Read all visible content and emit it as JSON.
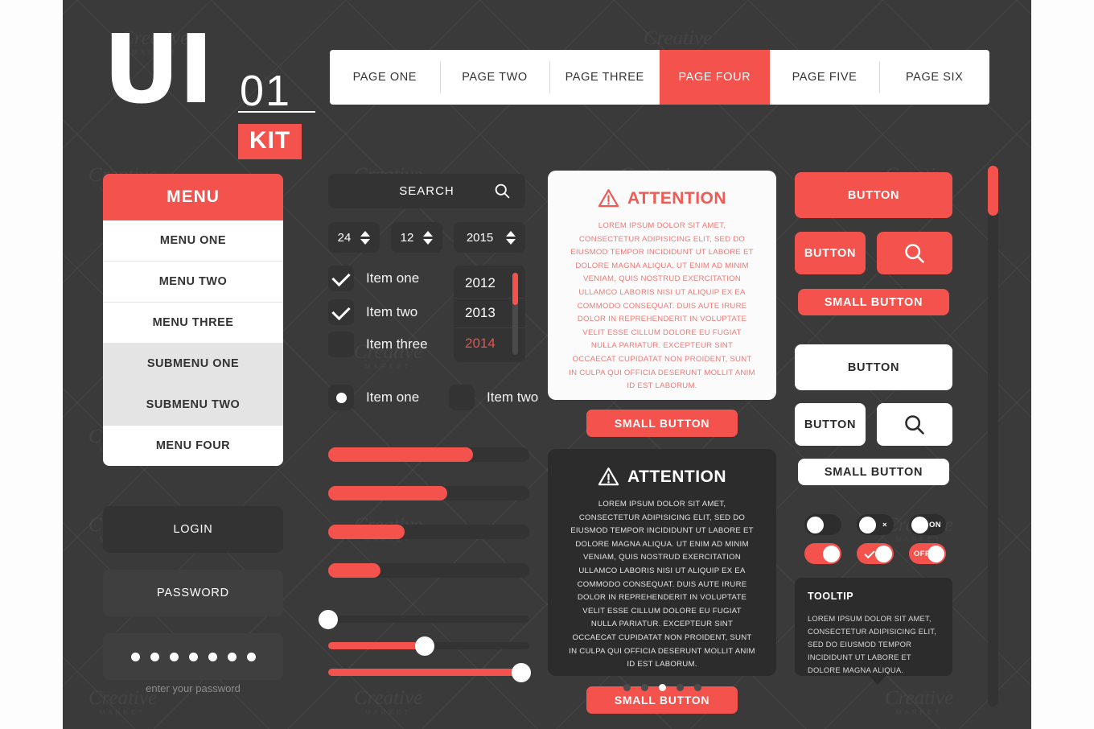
{
  "logo": {
    "ui": "UI",
    "num": "01",
    "kit": "KIT"
  },
  "topnav": {
    "tabs": [
      {
        "label": "PAGE ONE",
        "active": false
      },
      {
        "label": "PAGE TWO",
        "active": false
      },
      {
        "label": "PAGE THREE",
        "active": false
      },
      {
        "label": "PAGE FOUR",
        "active": true
      },
      {
        "label": "PAGE FIVE",
        "active": false
      },
      {
        "label": "PAGE SIX",
        "active": false
      }
    ]
  },
  "menu": {
    "title": "MENU",
    "items": [
      {
        "label": "MENU ONE",
        "sub": false
      },
      {
        "label": "MENU TWO",
        "sub": false
      },
      {
        "label": "MENU THREE",
        "sub": false
      },
      {
        "label": "SUBMENU ONE",
        "sub": true
      },
      {
        "label": "SUBMENU TWO",
        "sub": true
      },
      {
        "label": "MENU FOUR",
        "sub": false
      }
    ]
  },
  "auth": {
    "login_label": "LOGIN",
    "password_label": "PASSWORD",
    "password_dots": 7,
    "hint": "enter your password"
  },
  "search": {
    "label": "SEARCH",
    "icon": "search-icon"
  },
  "steppers": [
    {
      "name": "day",
      "value": "24"
    },
    {
      "name": "month",
      "value": "12"
    },
    {
      "name": "year",
      "value": "2015"
    }
  ],
  "checkboxes": [
    {
      "label": "Item one",
      "checked": true
    },
    {
      "label": "Item two",
      "checked": true
    },
    {
      "label": "Item three",
      "checked": false
    }
  ],
  "radios": [
    {
      "label": "Item one",
      "selected": true
    },
    {
      "label": "Item two",
      "selected": false
    }
  ],
  "year_select": {
    "options": [
      {
        "label": "2012",
        "selected": false
      },
      {
        "label": "2013",
        "selected": false
      },
      {
        "label": "2014",
        "selected": true
      }
    ],
    "scroll_percent": 0
  },
  "progress_bars": [
    {
      "percent": 72
    },
    {
      "percent": 59
    },
    {
      "percent": 38
    },
    {
      "percent": 26
    }
  ],
  "sliders": [
    {
      "percent": 0
    },
    {
      "percent": 48
    },
    {
      "percent": 96
    }
  ],
  "attention_light": {
    "title": "ATTENTION",
    "icon": "warning-triangle-icon",
    "body": "LOREM IPSUM DOLOR SIT AMET, CONSECTETUR ADIPISICING ELIT, SED DO EIUSMOD TEMPOR INCIDIDUNT UT LABORE ET DOLORE MAGNA ALIQUA. UT ENIM AD MINIM VENIAM, QUIS NOSTRUD EXERCITATION ULLAMCO LABORIS NISI UT ALIQUIP EX EA COMMODO CONSEQUAT. DUIS AUTE IRURE DOLOR IN REPREHENDERIT IN VOLUPTATE VELIT ESSE CILLUM DOLORE EU FUGIAT NULLA PARIATUR. EXCEPTEUR SINT OCCAECAT CUPIDATAT NON PROIDENT, SUNT IN CULPA QUI OFFICIA DESERUNT MOLLIT ANIM ID EST LABORUM.",
    "button": "SMALL BUTTON"
  },
  "attention_dark": {
    "title": "ATTENTION",
    "icon": "warning-triangle-icon",
    "body": "LOREM IPSUM DOLOR SIT AMET, CONSECTETUR ADIPISICING ELIT, SED DO EIUSMOD TEMPOR INCIDIDUNT UT LABORE ET DOLORE MAGNA ALIQUA. UT ENIM AD MINIM VENIAM, QUIS NOSTRUD EXERCITATION ULLAMCO LABORIS NISI UT ALIQUIP EX EA COMMODO CONSEQUAT. DUIS AUTE IRURE DOLOR IN REPREHENDERIT IN VOLUPTATE VELIT ESSE CILLUM DOLORE EU FUGIAT NULLA PARIATUR. EXCEPTEUR SINT OCCAECAT CUPIDATAT NON PROIDENT, SUNT IN CULPA QUI OFFICIA DESERUNT MOLLIT ANIM ID EST LABORUM.",
    "button": "SMALL BUTTON"
  },
  "pager": {
    "count": 5,
    "active_index": 2
  },
  "buttons": {
    "red_wide": "BUTTON",
    "red_small_left": "BUTTON",
    "red_icon": "search-icon",
    "red_small": "SMALL BUTTON",
    "white_wide": "BUTTON",
    "white_small_left": "BUTTON",
    "white_icon": "search-icon",
    "white_small": "SMALL BUTTON"
  },
  "toggles": [
    {
      "state": "off",
      "style": "plain",
      "text": ""
    },
    {
      "state": "off",
      "style": "cross",
      "text": "×"
    },
    {
      "state": "off",
      "style": "text",
      "text": "ON"
    },
    {
      "state": "on",
      "style": "plain",
      "text": ""
    },
    {
      "state": "on",
      "style": "check",
      "text": ""
    },
    {
      "state": "on",
      "style": "text",
      "text": "OFF"
    }
  ],
  "tooltip": {
    "title": "TOOLTIP",
    "body": "LOREM IPSUM DOLOR SIT AMET, CONSECTETUR ADIPISICING ELIT, SED DO EIUSMOD TEMPOR INCIDIDUNT UT LABORE ET DOLORE MAGNA ALIQUA."
  },
  "scrollbar": {
    "thumb_percent": 9
  },
  "colors": {
    "accent": "#f4524d",
    "background": "#3a3a3a",
    "panel": "#333333",
    "card_dark": "#2c2c2c",
    "white": "#ffffff"
  },
  "watermark": {
    "brand": "Creative",
    "sub": "MARKET"
  }
}
